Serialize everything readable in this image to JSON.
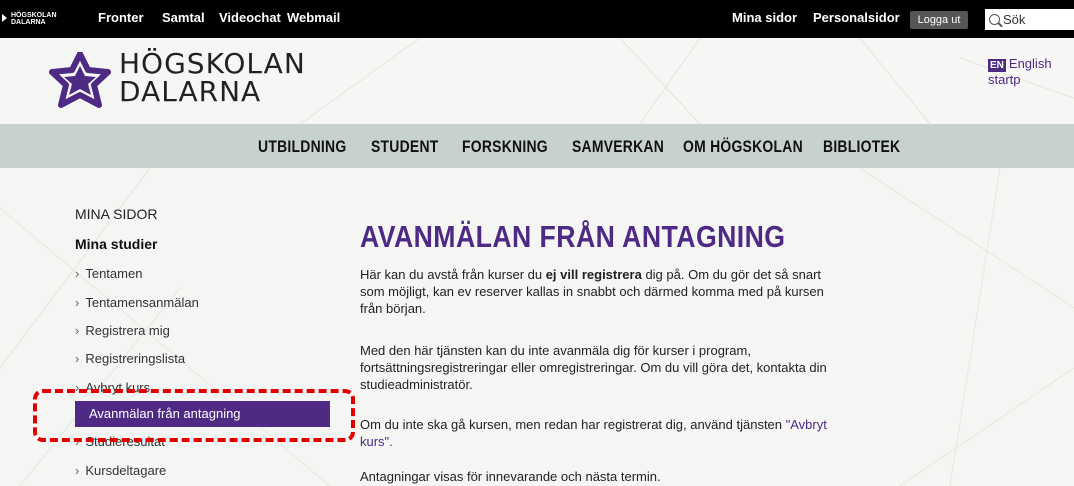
{
  "topbar": {
    "minilogo_line1": "HÖGSKOLAN",
    "minilogo_line2": "DALARNA",
    "links": [
      "Fronter",
      "Samtal",
      "Videochat",
      "Webmail"
    ],
    "right_links": [
      "Mina sidor",
      "Personalsidor"
    ],
    "logout": "Logga ut",
    "search_placeholder": "Sök"
  },
  "header": {
    "logo_line1": "HÖGSKOLAN",
    "logo_line2": "DALARNA",
    "english_badge": "EN",
    "english_link": "English startp"
  },
  "nav": {
    "items": [
      "UTBILDNING",
      "STUDENT",
      "FORSKNING",
      "SAMVERKAN",
      "OM HÖGSKOLAN",
      "BIBLIOTEK"
    ]
  },
  "sidebar": {
    "heading": "MINA SIDOR",
    "subheading": "Mina studier",
    "items": [
      "Tentamen",
      "Tentamensanmälan",
      "Registrera mig",
      "Registreringslista",
      "Avbryt kurs",
      "Avanmälan från antagning",
      "Studieresultat",
      "Kursdeltagare"
    ],
    "chevron": "›"
  },
  "main": {
    "title": "AVANMÄLAN FRÅN ANTAGNING",
    "p1_a": "Här kan du avstå från kurser du ",
    "p1_bold": "ej vill registrera",
    "p1_b": " dig på. Om du gör det så snart som möjligt, kan ev reserver kallas in snabbt och därmed komma med på kursen från början.",
    "p2": "Med den här tjänsten kan du inte avanmäla dig för kurser i program, fortsättningsregistreringar eller omregistreringar. Om du vill göra det, kontakta din studieadministratör.",
    "p3_a": "Om du inte ska gå kursen, men redan har registrerat dig, använd tjänsten ",
    "p3_link": "\"Avbryt kurs\".",
    "p4": "Antagningar visas för innevarande och nästa termin."
  },
  "colors": {
    "brand_purple": "#4e2a84",
    "nav_bg": "#c8d2cc",
    "annotation_red": "#e00000"
  }
}
